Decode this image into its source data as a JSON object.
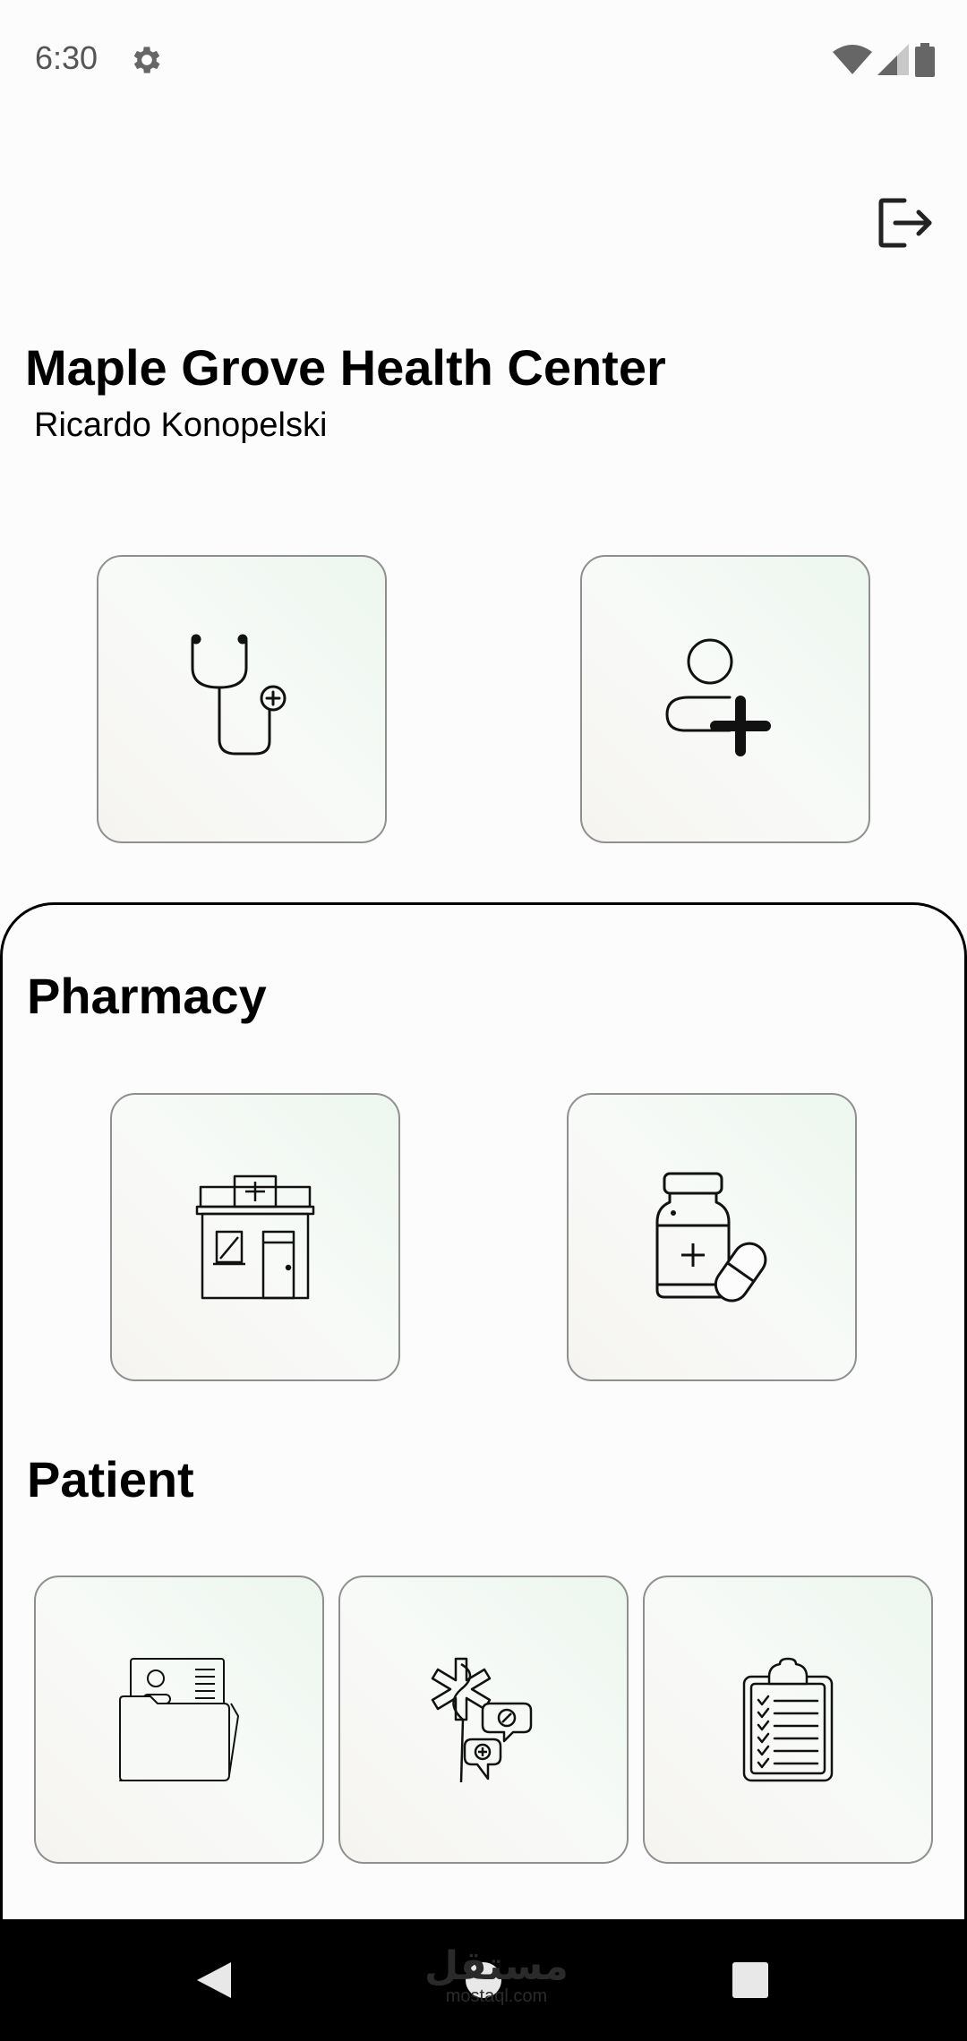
{
  "status_bar": {
    "time": "6:30",
    "icons": [
      "settings-icon",
      "wifi-icon",
      "cellular-signal-icon",
      "battery-icon"
    ]
  },
  "header": {
    "logout_icon": "logout-icon",
    "title": "Maple Grove Health Center",
    "user_name": "Ricardo Konopelski"
  },
  "top_actions": [
    {
      "icon": "stethoscope-icon"
    },
    {
      "icon": "add-user-icon"
    }
  ],
  "pharmacy": {
    "title": "Pharmacy",
    "items": [
      {
        "icon": "pharmacy-store-icon"
      },
      {
        "icon": "medicine-bottle-icon"
      }
    ]
  },
  "patient": {
    "title": "Patient",
    "items": [
      {
        "icon": "patient-records-folder-icon"
      },
      {
        "icon": "medical-chat-icon"
      },
      {
        "icon": "clipboard-checklist-icon"
      }
    ]
  },
  "nav_bar": {
    "icons": [
      "back-icon",
      "home-icon",
      "recents-icon"
    ]
  },
  "watermark": {
    "arabic": "مستقل",
    "latin": "mostaql.com"
  },
  "colors": {
    "background": "#fbfcfb",
    "tile_border": "#8f8f8f",
    "text": "#000000",
    "nav_bar": "#000000"
  }
}
